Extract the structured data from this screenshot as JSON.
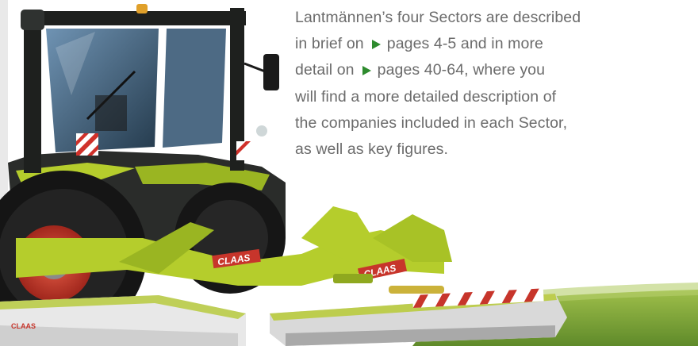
{
  "intro": {
    "line1": "Lantmännen’s four Sectors are described",
    "line2_a": "in brief on",
    "ref1": "pages 4-5",
    "line2_b": "and in more",
    "line3_a": "detail on",
    "ref2": "pages 40-64,",
    "line3_b": "where you",
    "line4": "will find a more detailed description of",
    "line5": "the companies included in each Sector,",
    "line6": "as well as key figures."
  },
  "photo": {
    "brand_text": "CLAAS",
    "colors": {
      "claas_green": "#b5cd2c",
      "tire_red": "#c8342a",
      "arrow_green": "#2e8b2e",
      "text_gray": "#6b6b6b"
    }
  }
}
